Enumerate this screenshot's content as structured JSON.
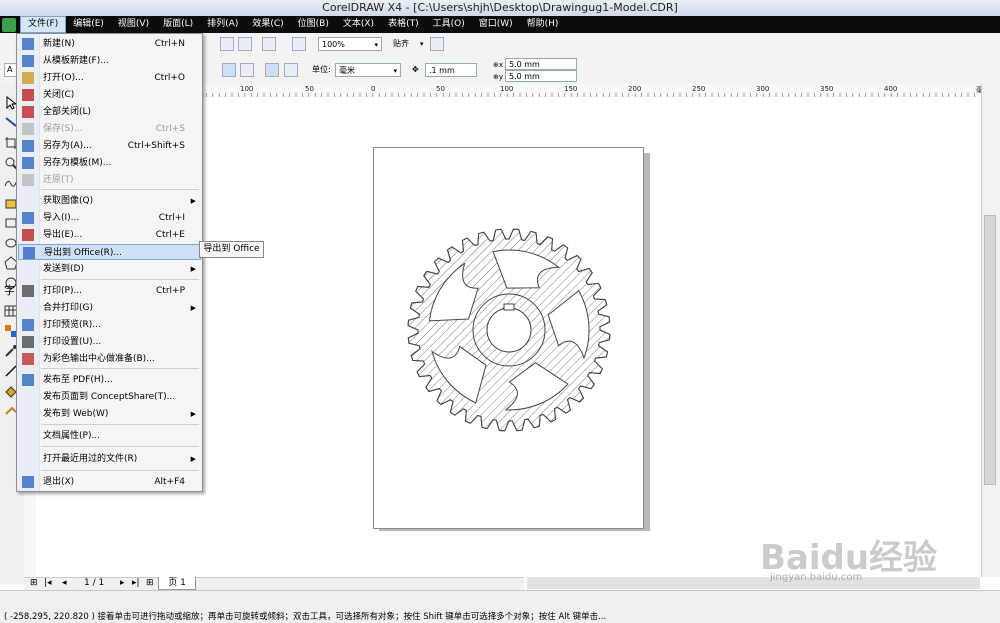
{
  "window": {
    "title": "CorelDRAW X4 - [C:\\Users\\shjh\\Desktop\\Drawingug1-Model.CDR]"
  },
  "menubar": {
    "items": [
      {
        "label": "文件(F)",
        "active": true
      },
      {
        "label": "编辑(E)"
      },
      {
        "label": "视图(V)"
      },
      {
        "label": "版面(L)"
      },
      {
        "label": "排列(A)"
      },
      {
        "label": "效果(C)"
      },
      {
        "label": "位图(B)"
      },
      {
        "label": "文本(X)"
      },
      {
        "label": "表格(T)"
      },
      {
        "label": "工具(O)"
      },
      {
        "label": "窗口(W)"
      },
      {
        "label": "帮助(H)"
      }
    ]
  },
  "toolbar": {
    "zoom": "100%",
    "snap_label": "贴齐",
    "unit_label": "单位:",
    "unit_value": "毫米",
    "nudge": ".1 mm",
    "dup_x": "5.0 mm",
    "dup_y": "5.0 mm",
    "prop_label": "A"
  },
  "ruler": {
    "h_labels": [
      "100",
      "50",
      "0",
      "50",
      "100",
      "150",
      "200",
      "250",
      "300",
      "350",
      "400",
      "毫米"
    ]
  },
  "file_menu": {
    "items": [
      {
        "label": "新建(N)",
        "shortcut": "Ctrl+N"
      },
      {
        "label": "从模板新建(F)..."
      },
      {
        "label": "打开(O)...",
        "shortcut": "Ctrl+O"
      },
      {
        "label": "关闭(C)"
      },
      {
        "label": "全部关闭(L)"
      },
      {
        "label": "保存(S)...",
        "shortcut": "Ctrl+S",
        "disabled": true
      },
      {
        "label": "另存为(A)...",
        "shortcut": "Ctrl+Shift+S"
      },
      {
        "label": "另存为模板(M)..."
      },
      {
        "label": "还原(T)",
        "disabled": true
      },
      {
        "label": "获取图像(Q)",
        "submenu": true
      },
      {
        "label": "导入(I)...",
        "shortcut": "Ctrl+I"
      },
      {
        "label": "导出(E)...",
        "shortcut": "Ctrl+E"
      },
      {
        "label": "导出到 Office(R)...",
        "highlighted": true
      },
      {
        "label": "发送到(D)",
        "submenu": true
      },
      {
        "label": "打印(P)...",
        "shortcut": "Ctrl+P"
      },
      {
        "label": "合并打印(G)",
        "submenu": true
      },
      {
        "label": "打印预览(R)..."
      },
      {
        "label": "打印设置(U)..."
      },
      {
        "label": "为彩色输出中心做准备(B)..."
      },
      {
        "label": "发布至 PDF(H)..."
      },
      {
        "label": "发布页面到 ConceptShare(T)..."
      },
      {
        "label": "发布到 Web(W)",
        "submenu": true
      },
      {
        "label": "文档属性(P)..."
      },
      {
        "label": "打开最近用过的文件(R)",
        "submenu": true
      },
      {
        "label": "退出(X)",
        "shortcut": "Alt+F4"
      }
    ],
    "tooltip": "导出到 Office"
  },
  "page_nav": {
    "counter": "1 / 1",
    "tab_label": "页 1"
  },
  "status": {
    "text": "( -258.295, 220.820 )   接着单击可进行拖动或缩放；再单击可旋转或倾斜；双击工具，可选择所有对象；按住 Shift 键单击可选择多个对象；按住 Alt 键单击..."
  },
  "watermark": {
    "brand": "Baidu经验",
    "url": "jingyan.baidu.com"
  },
  "colors": {
    "menubar_bg": "#0c0c0c",
    "highlight": "#cfe1f5",
    "gear_stroke": "#444444"
  }
}
